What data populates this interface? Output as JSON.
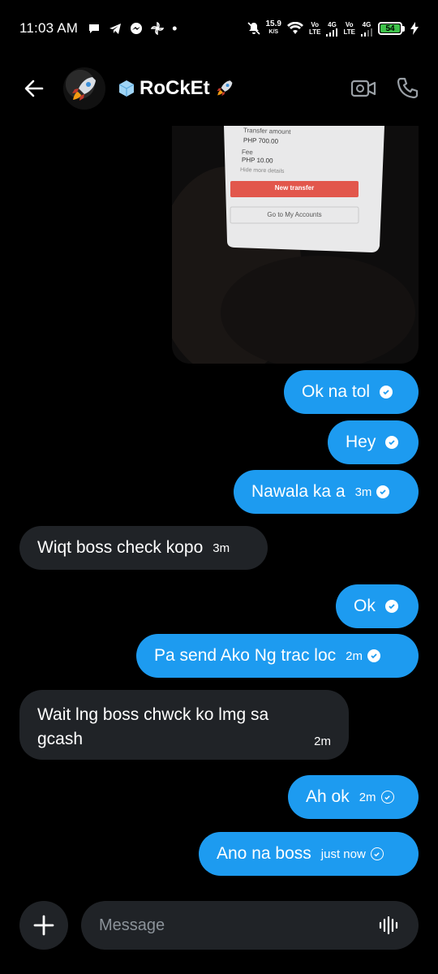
{
  "status_bar": {
    "time": "11:03 AM",
    "speed_value": "15.9",
    "speed_unit": "K/S",
    "net1_top": "Vo",
    "net1_bottom": "LTE",
    "net1_gen": "4G",
    "net2_top": "Vo",
    "net2_bottom": "LTE",
    "net2_gen": "4G",
    "battery": "54",
    "battery_color": "#3ec14a"
  },
  "header": {
    "title": "RoCkEt",
    "title_prefix_icon": "ice-cube-icon",
    "title_suffix_icon": "rocket-icon"
  },
  "photo": {
    "transfer_label": "Transfer amount",
    "transfer_amount": "PHP 700.00",
    "fee_label": "Fee",
    "fee_amount": "PHP 10.00",
    "hide_details": "Hide more details",
    "new_transfer": "New transfer",
    "go_to_accounts": "Go to My Accounts"
  },
  "messages": [
    {
      "dir": "out",
      "text": "Ok na tol",
      "time": "",
      "receipt": "read"
    },
    {
      "dir": "out",
      "text": "Hey",
      "time": "",
      "receipt": "read"
    },
    {
      "dir": "out",
      "text": "Nawala ka a",
      "time": "3m",
      "receipt": "read"
    },
    {
      "dir": "in",
      "text": "Wiqt boss check kopo",
      "time": "3m"
    },
    {
      "dir": "out",
      "text": "Ok",
      "time": "",
      "receipt": "read"
    },
    {
      "dir": "out",
      "text": "Pa send Ako Ng trac loc",
      "time": "2m",
      "receipt": "read"
    },
    {
      "dir": "in",
      "text": "Wait lng boss chwck ko lmg sa gcash",
      "time": "2m"
    },
    {
      "dir": "out",
      "text": "Ah ok",
      "time": "2m",
      "receipt": "sent"
    },
    {
      "dir": "out",
      "text": "Ano na boss",
      "time": "just now",
      "receipt": "sent"
    }
  ],
  "composer": {
    "placeholder": "Message"
  },
  "colors": {
    "outgoing_bubble": "#1d9bf0",
    "incoming_bubble": "#202327",
    "background": "#000000"
  }
}
